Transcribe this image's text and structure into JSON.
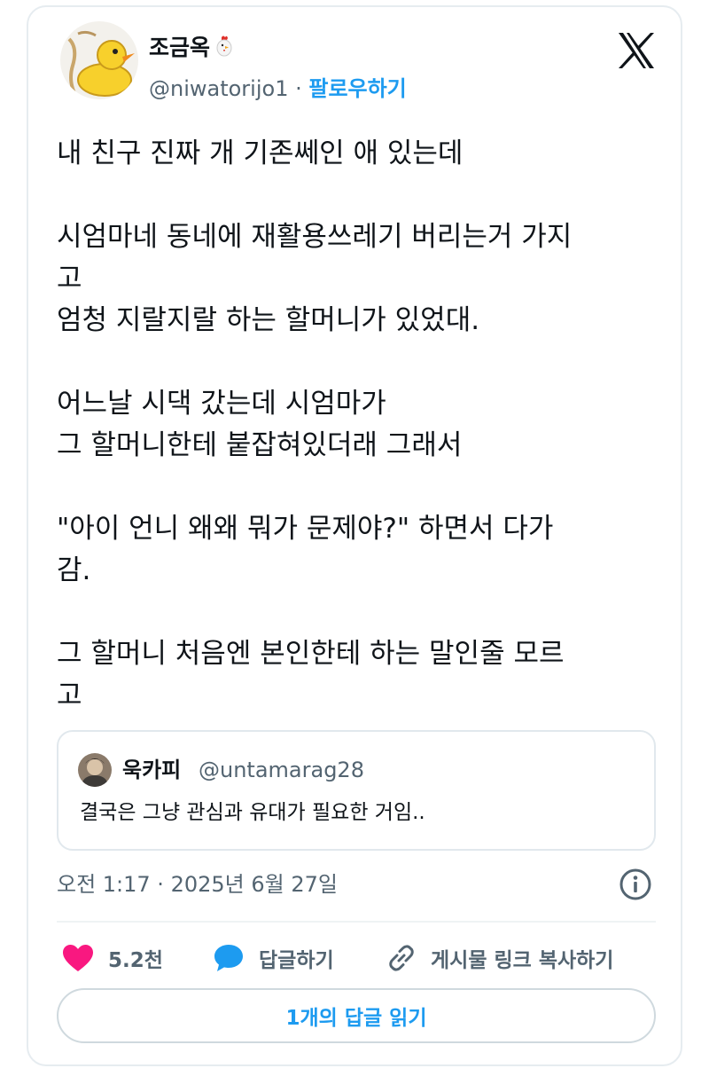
{
  "author": {
    "display_name": "조금옥",
    "name_emoji": "chicken-emoji",
    "handle": "@niwatorijo1",
    "separator": " · ",
    "follow_label": "팔로우하기",
    "avatar": "rubber-duck-keychain"
  },
  "platform_logo": "x-logo-icon",
  "tweet": {
    "lines": [
      "내 친구 진짜 개 기존쎄인 애 있는데",
      "",
      "시엄마네 동네에 재활용쓰레기 버리는거 가지",
      "고",
      "엄청 지랄지랄 하는 할머니가 있었대.",
      "",
      "어느날 시댁 갔는데 시엄마가",
      "그 할머니한테 붙잡혀있더래 그래서",
      "",
      "\"아이 언니 왜왜 뭐가 문제야?\" 하면서 다가",
      "감.",
      "",
      "그 할머니 처음엔 본인한테 하는 말인줄 모르",
      "고"
    ]
  },
  "quote": {
    "display_name": "욱카피",
    "handle": "@untamarag28",
    "text": "결국은 그냥 관심과 유대가 필요한 거임.."
  },
  "timestamp": "오전 1:17 · 2025년 6월 27일",
  "actions": {
    "like_count": "5.2천",
    "reply_label": "답글하기",
    "copy_link_label": "게시물 링크 복사하기"
  },
  "read_replies_label": "1개의 답글 읽기",
  "colors": {
    "accent": "#1d9bf0",
    "like": "#f91880",
    "secondary_text": "#536471",
    "border": "#e6ecf0"
  }
}
